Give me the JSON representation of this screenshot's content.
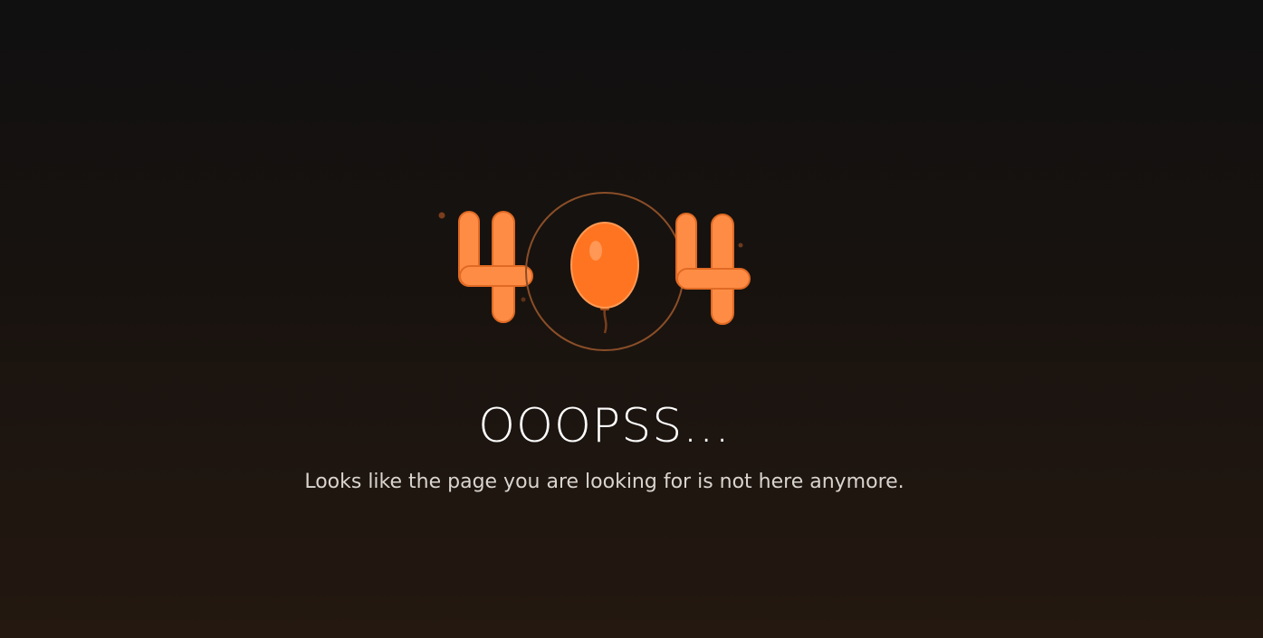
{
  "error": {
    "code_digits": [
      "4",
      "0",
      "4"
    ],
    "title": "OOOPSS...",
    "message": "Looks like the page you are looking for is not here anymore."
  },
  "icons": {
    "balloon": "balloon-icon",
    "circle": "ring-outline"
  },
  "colors": {
    "background_top": "#101010",
    "background_bottom": "#241810",
    "accent": "#ff7a2e",
    "accent_light": "#ff8c45",
    "ring": "#8a4e28",
    "title": "#ffffff",
    "message": "#d9d4cf"
  }
}
